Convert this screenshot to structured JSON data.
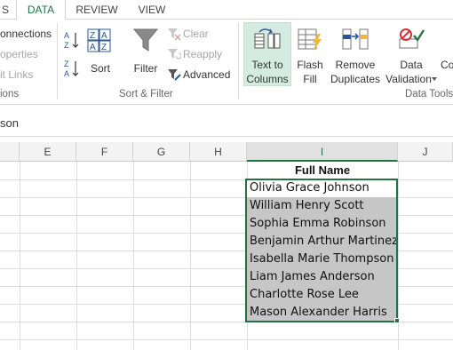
{
  "ribbon_tabs": [
    {
      "label": "S"
    },
    {
      "label": "DATA"
    },
    {
      "label": "REVIEW"
    },
    {
      "label": "VIEW"
    }
  ],
  "connections_group": {
    "connections": "onnections",
    "properties": "operties",
    "edit_links": "it Links",
    "label": "ions"
  },
  "sort_filter_group": {
    "sort": "Sort",
    "filter": "Filter",
    "clear": "Clear",
    "reapply": "Reapply",
    "advanced": "Advanced",
    "label": "Sort & Filter"
  },
  "data_tools_group": {
    "text_to_columns": [
      "Text to",
      "Columns"
    ],
    "flash_fill": [
      "Flash",
      "Fill"
    ],
    "remove_duplicates": [
      "Remove",
      "Duplicates"
    ],
    "data_validation": [
      "Data",
      "Validation"
    ],
    "consolidate": "Co",
    "label": "Data Tools"
  },
  "formula_bar": {
    "text": "son"
  },
  "columns": [
    "E",
    "F",
    "G",
    "H",
    "I",
    "J"
  ],
  "table": {
    "header": "Full Name",
    "rows": [
      "Olivia Grace Johnson",
      "William Henry Scott",
      "Sophia Emma Robinson",
      "Benjamin Arthur Martinez",
      "Isabella Marie Thompson",
      "Liam James Anderson",
      "Charlotte Rose Lee",
      "Mason Alexander Harris"
    ]
  },
  "colors": {
    "accent": "#217346",
    "selected_fill": "#c6c6c6",
    "button_highlight": "#d3ebe0"
  }
}
